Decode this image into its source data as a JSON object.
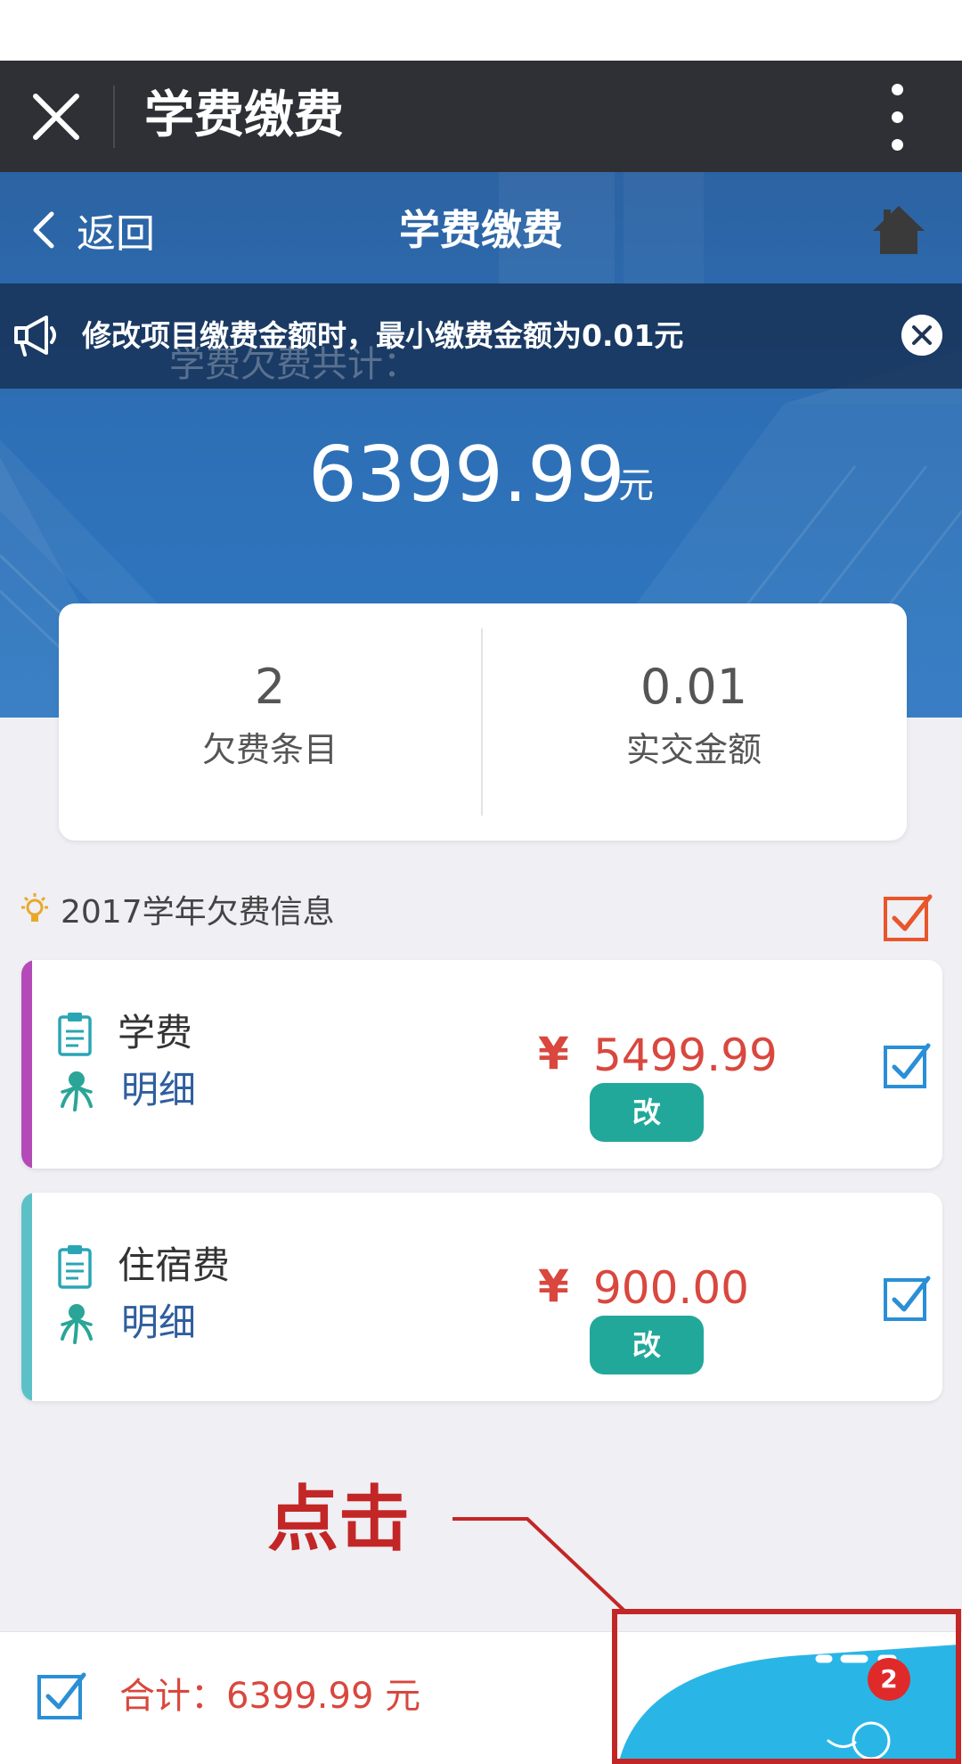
{
  "wechat_bar": {
    "title": "学费缴费",
    "close_icon": "close-icon",
    "more_icon": "more-vertical-icon"
  },
  "nav": {
    "back_label": "返回",
    "title": "学费缴费",
    "home_icon": "home-icon"
  },
  "notice": {
    "text": "修改项目缴费金额时，最小缴费金额为0.01元",
    "ghost_text": "学费欠费共计：",
    "icon": "megaphone-icon"
  },
  "summary": {
    "total_amount": "6399.99",
    "unit": "元"
  },
  "stats": [
    {
      "value": "2",
      "label": "欠费条目"
    },
    {
      "value": "0.01",
      "label": "实交金额"
    }
  ],
  "section": {
    "title": "2017学年欠费信息",
    "icon": "lightbulb-icon"
  },
  "fees": [
    {
      "name": "学费",
      "detail_label": "明细",
      "currency": "¥",
      "amount": "5499.99",
      "edit_label": "改",
      "checked": true,
      "accent": "#b44ab8"
    },
    {
      "name": "住宿费",
      "detail_label": "明细",
      "currency": "¥",
      "amount": "900.00",
      "edit_label": "改",
      "checked": true,
      "accent": "#5cc1c6"
    }
  ],
  "annotation": {
    "text": "点击"
  },
  "bottom": {
    "total_label": "合计：6399.99 元",
    "pay_badge": "2"
  },
  "colors": {
    "wechat_bar": "#2e3035",
    "hero_blue": "#2d6fb5",
    "price_red": "#d9473e",
    "teal_button": "#22a89a",
    "check_blue": "#2a8fd6",
    "check_orange": "#e8562a",
    "annotation_red": "#c32626",
    "pay_button_blue": "#29b6e6"
  }
}
